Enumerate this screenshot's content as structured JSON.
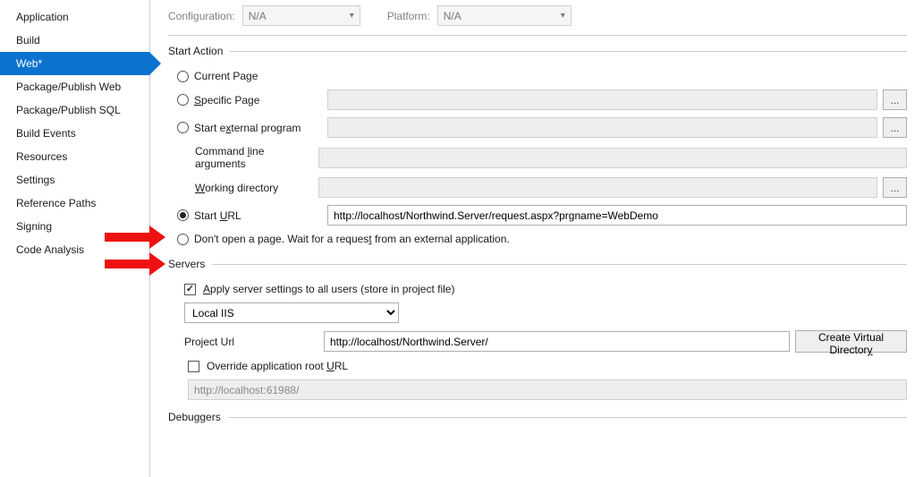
{
  "sidebar": {
    "items": [
      {
        "label": "Application"
      },
      {
        "label": "Build"
      },
      {
        "label": "Web*",
        "selected": true
      },
      {
        "label": "Package/Publish Web"
      },
      {
        "label": "Package/Publish SQL"
      },
      {
        "label": "Build Events"
      },
      {
        "label": "Resources"
      },
      {
        "label": "Settings"
      },
      {
        "label": "Reference Paths"
      },
      {
        "label": "Signing"
      },
      {
        "label": "Code Analysis"
      }
    ]
  },
  "top": {
    "config_label": "Configuration:",
    "config_value": "N/A",
    "platform_label": "Platform:",
    "platform_value": "N/A"
  },
  "start_action": {
    "title": "Start Action",
    "current_page": "Current Page",
    "specific_pre": "",
    "specific_key": "S",
    "specific_post": "pecific Page",
    "ext_pre": "Start e",
    "ext_key": "x",
    "ext_post": "ternal program",
    "cmd_pre": "Command ",
    "cmd_key": "l",
    "cmd_post": "ine arguments",
    "wd_pre": "",
    "wd_key": "W",
    "wd_post": "orking directory",
    "url_pre": "Start ",
    "url_key": "U",
    "url_post": "RL",
    "url_value": "http://localhost/Northwind.Server/request.aspx?prgname=WebDemo",
    "noopen_pre": "Don't open a page.  Wait for a reques",
    "noopen_key": "t",
    "noopen_post": " from an external application.",
    "browse": "..."
  },
  "servers": {
    "title": "Servers",
    "apply_pre": "",
    "apply_key": "A",
    "apply_post": "pply server settings to all users (store in project file)",
    "server_type": "Local IIS",
    "project_url_label": "Project Url",
    "project_url_value": "http://localhost/Northwind.Server/",
    "create_vd_pre": "Create Virtual Director",
    "create_vd_key": "y",
    "override_pre": "Override application root ",
    "override_key": "U",
    "override_post": "RL",
    "override_value": "http://localhost:61988/"
  },
  "debuggers": {
    "title": "Debuggers"
  }
}
